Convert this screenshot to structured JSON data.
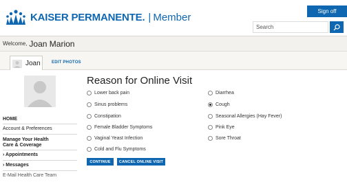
{
  "header": {
    "brand": "KAISER PERMANENTE.",
    "separator": "|",
    "section": "Member",
    "signoff": "Sign off",
    "search_placeholder": "Search"
  },
  "welcome": {
    "label": "Welcome,",
    "name": "Joan Marion"
  },
  "tabs": {
    "active_name": "Joan",
    "edit_photos": "EDIT PHOTOS"
  },
  "sidebar": {
    "home": "HOME",
    "account": "Account & Preferences",
    "manage_line1": "Manage Your Health",
    "manage_line2": "Care & Coverage",
    "appointments": "› Appointments",
    "messages": "› Messages",
    "email_team": "E-Mail Health Care Team"
  },
  "main": {
    "heading": "Reason for Online Visit",
    "options_left": [
      "Lower back pain",
      "Sinus problems",
      "Constipation",
      "Female Bladder Symptoms",
      "Vaginal Yeast Infection",
      "Cold and Flu Symptoms"
    ],
    "options_right": [
      "Diarrhea",
      "Cough",
      "Seasonal Allergies (Hay Fever)",
      "Pink Eye",
      "Sore Throat"
    ],
    "selected": "Cough",
    "continue_label": "CONTINUE",
    "cancel_label": "CANCEL ONLINE VISIT"
  },
  "colors": {
    "brand_blue": "#0e67b0"
  }
}
